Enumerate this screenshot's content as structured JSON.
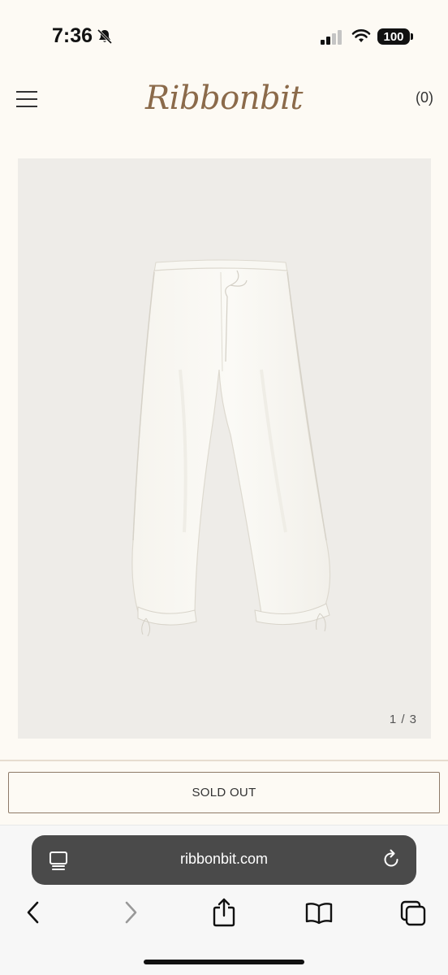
{
  "status_bar": {
    "time": "7:36",
    "battery": "100"
  },
  "header": {
    "logo": "Ribbonbit",
    "cart": "(0)"
  },
  "gallery": {
    "counter": "1 / 3"
  },
  "product": {
    "sold_out_label": "SOLD OUT"
  },
  "browser": {
    "url": "ribbonbit.com"
  },
  "colors": {
    "background": "#fdfaf4",
    "logo": "#8b6a4a",
    "image_bg": "#eeece8",
    "button_border": "#8e7a68"
  }
}
